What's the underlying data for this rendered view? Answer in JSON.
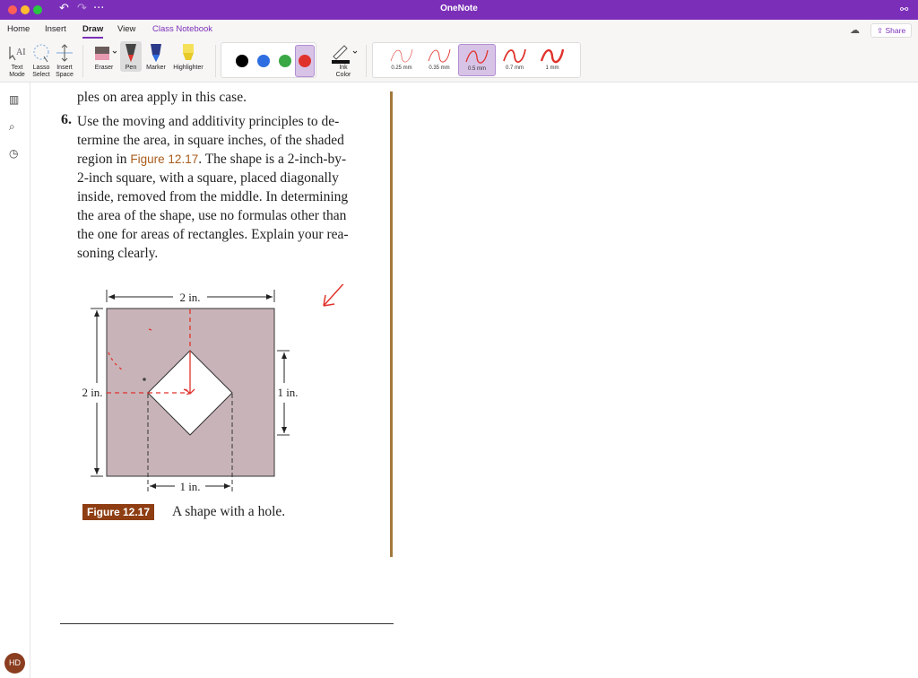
{
  "window": {
    "title": "OneNote"
  },
  "tabs": {
    "home": "Home",
    "insert": "Insert",
    "draw": "Draw",
    "view": "View",
    "class_notebook": "Class Notebook"
  },
  "share_label": "Share",
  "tools": {
    "text_mode_1": "Text",
    "text_mode_2": "Mode",
    "lasso_1": "Lasso",
    "lasso_2": "Select",
    "insert_space_1": "Insert",
    "insert_space_2": "Space",
    "eraser": "Eraser",
    "pen": "Pen",
    "marker": "Marker",
    "highlighter": "Highlighter",
    "ink_color_1": "Ink",
    "ink_color_2": "Color"
  },
  "pen_colors": [
    "#000000",
    "#2f6ee0",
    "#3aa845",
    "#e0322c"
  ],
  "selected_pen_color": "#e0322c",
  "thicknesses": [
    "0.25 mm",
    "0.35 mm",
    "0.5 mm",
    "0.7 mm",
    "1 mm"
  ],
  "selected_thickness": "0.5 mm",
  "user_initials": "HD",
  "content": {
    "top_line": "ples on area apply in this case.",
    "problem_number": "6.",
    "line1": "Use the moving and additivity principles to de-",
    "line2": "termine the area, in square inches, of the shaded",
    "line3_pre": "region in ",
    "line3_ref": "Figure 12.17",
    "line3_post": ". The shape is a 2-inch-by-",
    "line4": "2-inch square, with a square, placed diagonally",
    "line5": "inside, removed from the middle. In determining",
    "line6": "the area of the shape, use no formulas other than",
    "line7": "the one for areas of rectangles. Explain your rea-",
    "line8": "soning clearly."
  },
  "figure": {
    "top_label": "2 in.",
    "left_label": "2 in.",
    "right_label": "1 in.",
    "bottom_label": "1 in.",
    "caption_badge": "Figure 12.17",
    "caption_text": "A shape with a hole."
  },
  "colors": {
    "accent": "#7b2fb8",
    "shape_fill": "#c8b4b8",
    "ink_red": "#e0322c",
    "figure_badge": "#8e3e12"
  }
}
